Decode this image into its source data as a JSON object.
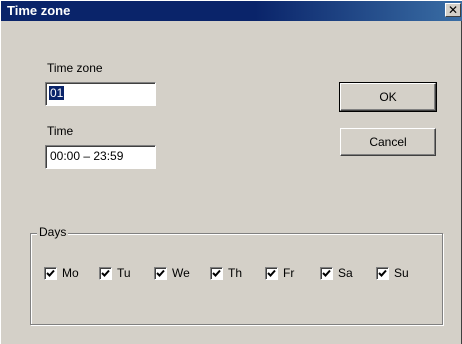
{
  "window": {
    "title": "Time zone",
    "close_glyph": "✕"
  },
  "form": {
    "timezone_label": "Time zone",
    "timezone_value": "01",
    "time_label": "Time",
    "time_value": "00:00  – 23:59"
  },
  "buttons": {
    "ok_label": "OK",
    "cancel_label": "Cancel"
  },
  "days": {
    "group_label": "Days",
    "items": [
      {
        "label": "Mo",
        "checked": true
      },
      {
        "label": "Tu",
        "checked": true
      },
      {
        "label": "We",
        "checked": true
      },
      {
        "label": "Th",
        "checked": true
      },
      {
        "label": "Fr",
        "checked": true
      },
      {
        "label": "Sa",
        "checked": true
      },
      {
        "label": "Su",
        "checked": true
      }
    ]
  }
}
